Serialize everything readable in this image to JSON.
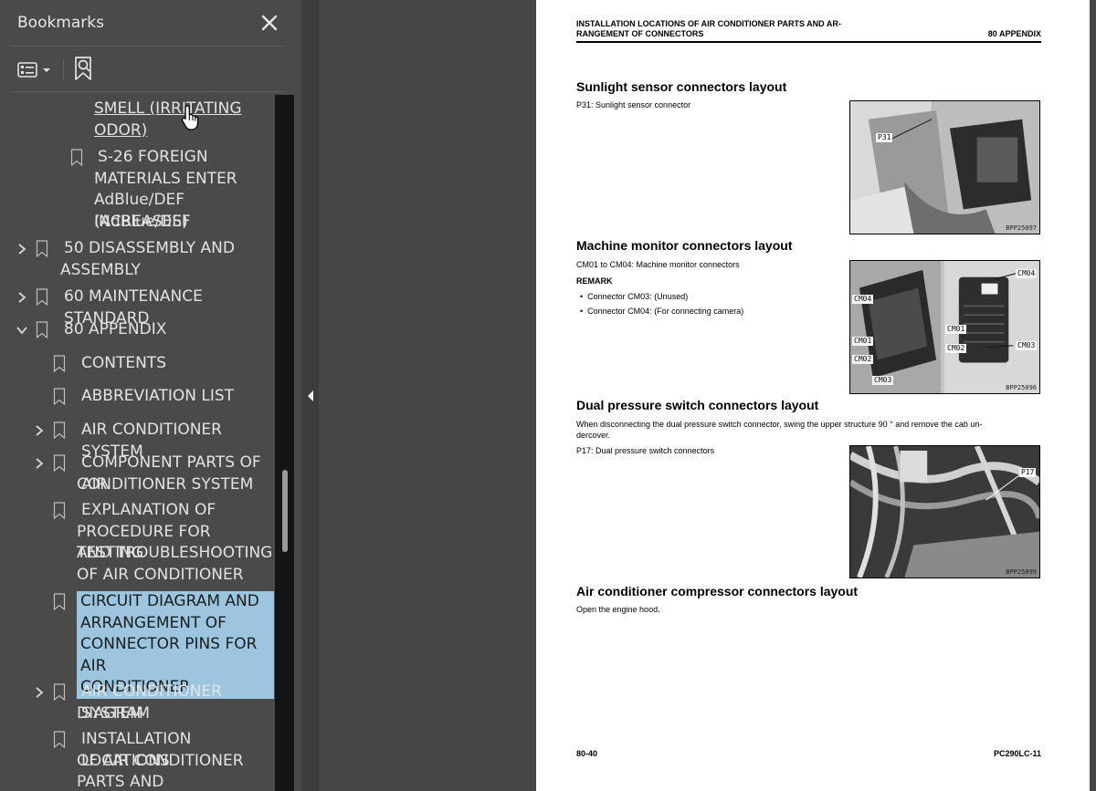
{
  "bookmarks_panel": {
    "title": "Bookmarks",
    "close_icon": "close-icon",
    "options_icon": "list-options-icon",
    "find_icon": "find-current-bookmark-icon",
    "items": [
      {
        "label": "SMELL (IRRITATING ODOR)",
        "lines": [
          "SMELL (IRRITATING",
          "ODOR)"
        ],
        "state": "hover-link"
      },
      {
        "label": "S-26 FOREIGN MATERIALS ENTER AdBlue/DEF (AdBlue/DEF INCREASES)",
        "lines": [
          "S-26 FOREIGN",
          "MATERIALS ENTER",
          "AdBlue/DEF (AdBlue/DEF",
          "INCREASES)"
        ]
      },
      {
        "label": "50 DISASSEMBLY AND ASSEMBLY",
        "lines": [
          "50 DISASSEMBLY AND",
          "ASSEMBLY"
        ],
        "expand": "collapsed"
      },
      {
        "label": "60 MAINTENANCE STANDARD",
        "lines": [
          "60 MAINTENANCE STANDARD"
        ],
        "expand": "collapsed"
      },
      {
        "label": "80 APPENDIX",
        "lines": [
          "80 APPENDIX"
        ],
        "expand": "expanded"
      },
      {
        "label": "CONTENTS",
        "lines": [
          "CONTENTS"
        ]
      },
      {
        "label": "ABBREVIATION LIST",
        "lines": [
          "ABBREVIATION LIST"
        ]
      },
      {
        "label": "AIR CONDITIONER SYSTEM",
        "lines": [
          "AIR CONDITIONER SYSTEM"
        ],
        "expand": "collapsed"
      },
      {
        "label": "COMPONENT PARTS OF AIR CONDITIONER SYSTEM",
        "lines": [
          "COMPONENT PARTS OF AIR",
          "CONDITIONER SYSTEM"
        ],
        "expand": "collapsed"
      },
      {
        "label": "EXPLANATION OF PROCEDURE FOR TESTING AND TROUBLESHOOTING OF AIR CONDITIONER",
        "lines": [
          "EXPLANATION OF",
          "PROCEDURE FOR TESTING",
          "AND TROUBLESHOOTING",
          "OF AIR CONDITIONER"
        ]
      },
      {
        "label": "CIRCUIT DIAGRAM AND ARRANGEMENT OF CONNECTOR PINS FOR AIR CONDITIONER",
        "lines": [
          "CIRCUIT DIAGRAM AND",
          "ARRANGEMENT OF",
          "CONNECTOR PINS FOR AIR",
          "CONDITIONER"
        ],
        "state": "selected"
      },
      {
        "label": "AIR CONDITIONER SYSTEM DIAGRAM",
        "lines": [
          "AIR CONDITIONER SYSTEM",
          "DIAGRAM"
        ],
        "expand": "collapsed"
      },
      {
        "label": "INSTALLATION LOCATIONS OF AIR CONDITIONER PARTS AND ARRANGEMENT",
        "lines": [
          "INSTALLATION LOCATIONS",
          "OF AIR CONDITIONER",
          "PARTS AND ARRANGEMENT"
        ]
      }
    ]
  },
  "page": {
    "header_title_lines": [
      "INSTALLATION LOCATIONS OF AIR CONDITIONER PARTS AND AR-",
      "RANGEMENT OF CONNECTORS"
    ],
    "header_section": "80 APPENDIX",
    "sections": [
      {
        "heading": "Sunlight sensor connectors layout",
        "text": [
          "P31: Sunlight sensor connector"
        ],
        "figure_code": "BPP25097",
        "figure_labels": [
          "P31"
        ]
      },
      {
        "heading": "Machine monitor connectors layout",
        "text": [
          "CM01 to CM04: Machine monitor connectors"
        ],
        "remark_title": "REMARK",
        "bullets": [
          "Connector CM03: (Unused)",
          "Connector CM04: (For connecting camera)"
        ],
        "figure_code": "BPP25096",
        "figure_labels": [
          "CM04",
          "CM04",
          "CM01",
          "CM02",
          "CM03",
          "CM01",
          "CM02",
          "CM03"
        ]
      },
      {
        "heading": "Dual pressure switch connectors layout",
        "text": [
          "When disconnecting the dual pressure switch connector, swing the upper structure 90 ° and remove the cab un-",
          "dercover.",
          "P17: Dual pressure switch connectors"
        ],
        "figure_code": "BPP25099",
        "figure_labels": [
          "P17"
        ]
      },
      {
        "heading": "Air conditioner compressor connectors layout",
        "text": [
          "Open the engine hood."
        ]
      }
    ],
    "footer_left": "80-40",
    "footer_right": "PC290LC-11"
  }
}
